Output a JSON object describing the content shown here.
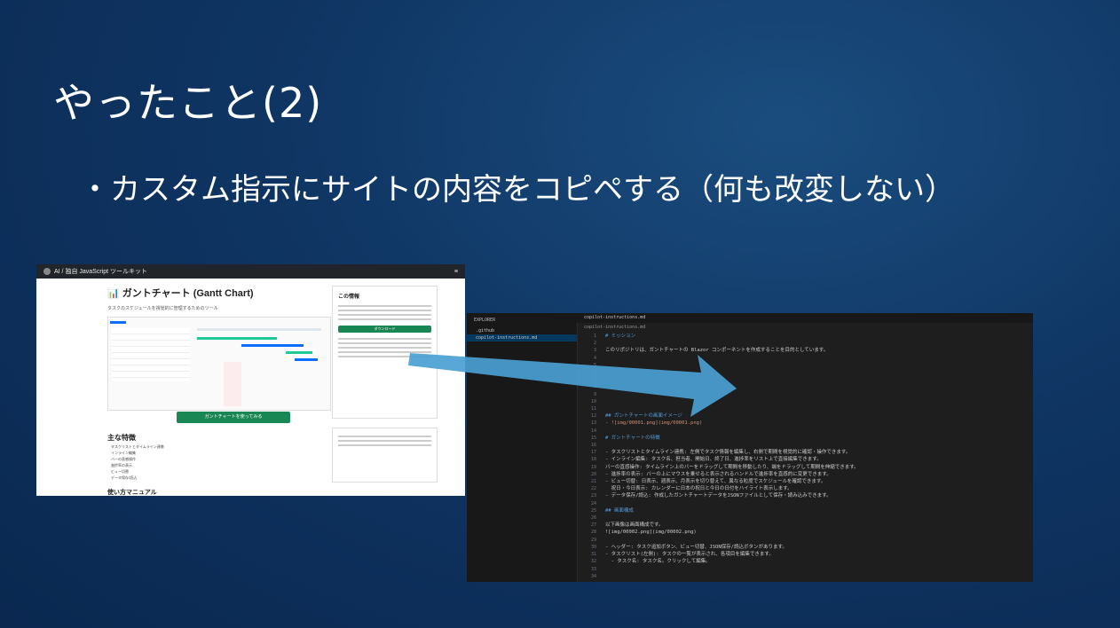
{
  "slide": {
    "title": "やったこと(2)",
    "bullet": "・カスタム指示にサイトの内容をコピペする（何も改変しない）"
  },
  "web_screenshot": {
    "nav_brand": "AI / 独自 JavaScript ツールキット",
    "page_title": "📊 ガントチャート (Gantt Chart)",
    "subtitle": "タスクのスケジュールを視覚的に管理するためのツール",
    "button_label": "ガントチャートを使ってみる",
    "features_heading": "主な特徴",
    "features": [
      "タスクリストとタイムライン連携",
      "インライン編集",
      "バーの直感操作",
      "進捗率の表示",
      "ビュー切替",
      "データ保存/読込"
    ],
    "manual_heading": "使い方マニュアル",
    "side_title": "この情報",
    "side_button": "ダウンロード"
  },
  "editor_screenshot": {
    "explorer_header": "EXPLORER",
    "explorer_items": [
      ".github",
      "copilot-instructions.md"
    ],
    "tab": "copilot-instructions.md",
    "line_numbers": [
      "1",
      "2",
      "3",
      "4",
      "5",
      "6",
      "7",
      "8",
      "9",
      "10",
      "11",
      "12",
      "13",
      "14",
      "15",
      "16",
      "17",
      "18",
      "19",
      "20",
      "21",
      "22",
      "23",
      "24",
      "25",
      "26",
      "27",
      "28",
      "29",
      "30",
      "31",
      "32",
      "33",
      "34"
    ],
    "code_lines": [
      "# ミッション",
      "",
      "このリポジトリは、ガントチャートの Blazor コンポーネントを作成することを目的としています。",
      "",
      "",
      "",
      "",
      "",
      "",
      "",
      "",
      "## ガントチャートの画面イメージ",
      "- ![img/00001.png](img/00001.png)",
      "",
      "# ガントチャートの特徴",
      "",
      "- タスクリストとタイムライン連携: 左側でタスク情報を編集し、右側で期間を視覚的に確認・操作できます。",
      "- インライン編集: タスク名、担当者、開始日、終了日、進捗率をリスト上で直接編集できます。",
      "バーの直感操作: タイムライン上のバーをドラッグして期間を移動したり、端をドラッグして期間を伸縮できます。",
      "- 進捗率の表示: バーの上にマウスを乗せると表示されるハンドルで進捗率を直感的に変更できます。",
      "- ビュー切替: 日表示、週表示、月表示を切り替えて、異なる粒度でスケジュールを確認できます。",
      "  祝日・今日表示: カレンダーに日本の祝日と今日の日付をハイライト表示します。",
      "- データ保存/読込: 作成したガントチャートデータをJSONファイルとして保存・読み込みできます。",
      "",
      "## 画面構成",
      "",
      "以下画像は画面構成です。",
      "![img/00002.png](img/00002.png)",
      "",
      "- ヘッダー: タスク追加ボタン、ビュー切替、JSON保存/読込ボタンがあります。",
      "- タスクリスト(左側): タスクの一覧が表示され、各項目を編集できます。",
      "  - タスク名: タスク名。クリックして編集。"
    ]
  }
}
